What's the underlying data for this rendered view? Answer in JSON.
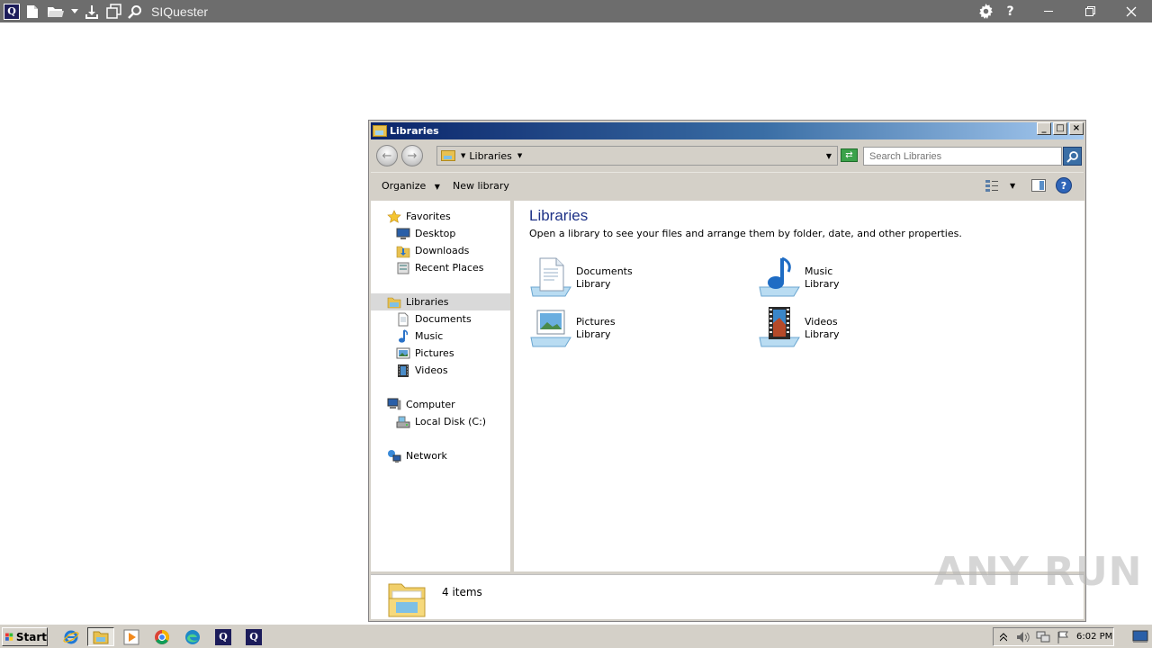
{
  "app": {
    "title": "SIQuester",
    "logo_letter": "Q"
  },
  "explorer": {
    "window_title": "Libraries",
    "address": {
      "crumb": "Libraries"
    },
    "search": {
      "placeholder": "Search Libraries"
    },
    "toolbar": {
      "organize_label": "Organize",
      "new_library_label": "New library"
    },
    "nav": {
      "favorites": "Favorites",
      "desktop": "Desktop",
      "downloads": "Downloads",
      "recent_places": "Recent Places",
      "libraries": "Libraries",
      "documents": "Documents",
      "music": "Music",
      "pictures": "Pictures",
      "videos": "Videos",
      "computer": "Computer",
      "local_disk": "Local Disk (C:)",
      "network": "Network"
    },
    "content": {
      "title": "Libraries",
      "description": "Open a library to see your files and arrange them by folder, date, and other properties.",
      "libraries": [
        {
          "name": "Documents",
          "subtitle": "Library",
          "icon": "documents-library-icon"
        },
        {
          "name": "Music",
          "subtitle": "Library",
          "icon": "music-library-icon"
        },
        {
          "name": "Pictures",
          "subtitle": "Library",
          "icon": "pictures-library-icon"
        },
        {
          "name": "Videos",
          "subtitle": "Library",
          "icon": "videos-library-icon"
        }
      ]
    },
    "details": {
      "item_count": "4 items"
    }
  },
  "watermark": "ANY RUN",
  "taskbar": {
    "start_label": "Start",
    "clock": "6:02 PM"
  },
  "colors": {
    "app_bar": "#6d6d6d",
    "title_gradient_start": "#0a246a",
    "content_title": "#1e3287",
    "taskbar": "#d4d0c8"
  }
}
